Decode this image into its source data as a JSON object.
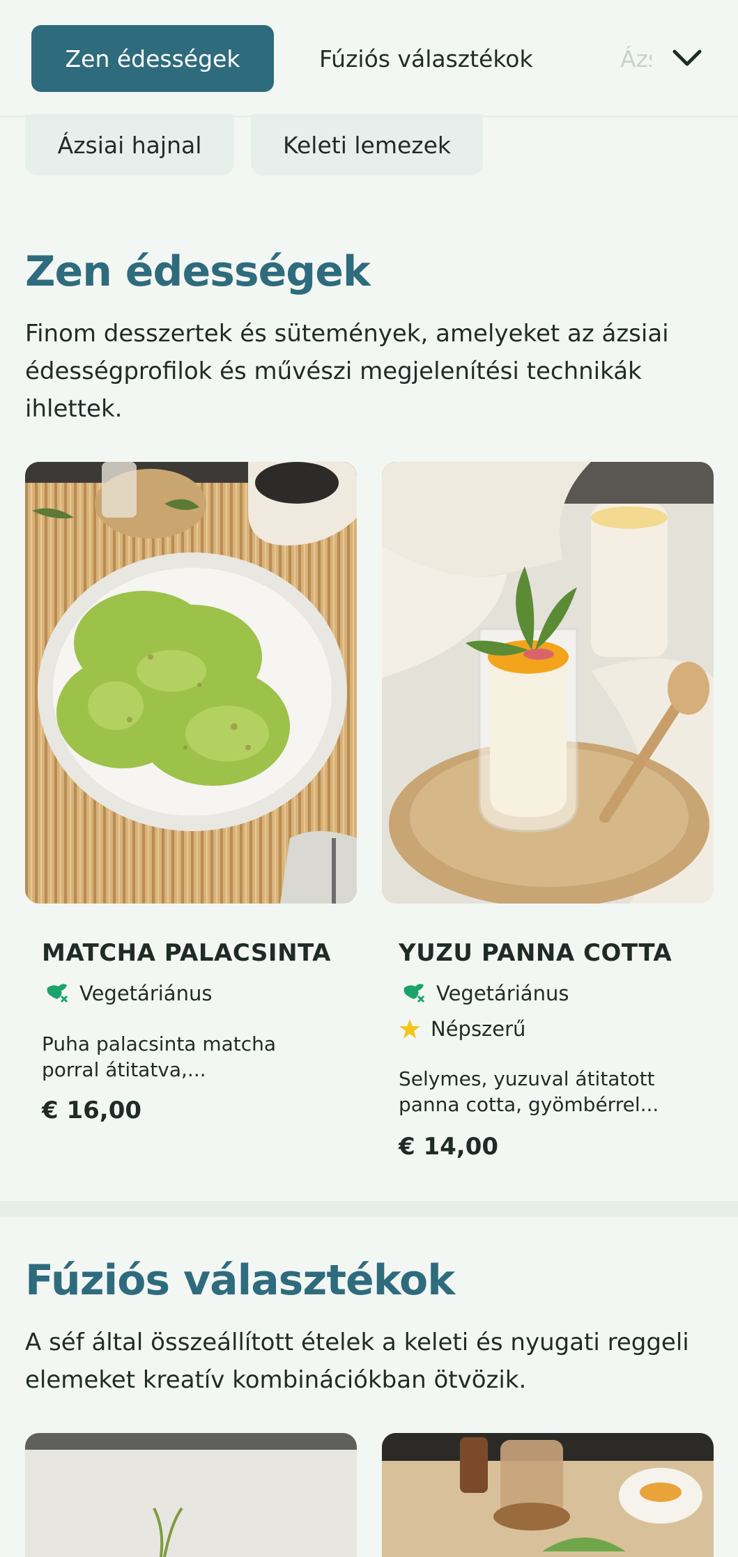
{
  "nav": {
    "tabs": [
      {
        "label": "Zen édességek"
      },
      {
        "label": "Fúziós választékok"
      },
      {
        "label": "Ázsiai hajnal"
      }
    ],
    "more_icon": "chevron-down-icon"
  },
  "subnav": {
    "chips": [
      {
        "label": "Ázsiai hajnal"
      },
      {
        "label": "Keleti lemezek"
      }
    ]
  },
  "sections": [
    {
      "title": "Zen édességek",
      "description": "Finom desszertek és sütemények, amelyeket az ázsiai édességprofilok és művészi megjelenítési technikák ihlettek.",
      "items": [
        {
          "name": "MATCHA PALACSINTA",
          "tags": [
            {
              "icon": "vegetarian-icon",
              "label": "Vegetáriánus"
            }
          ],
          "description": "Puha palacsinta matcha porral átitatva,...",
          "price": "€ 16,00"
        },
        {
          "name": "YUZU PANNA COTTA",
          "tags": [
            {
              "icon": "vegetarian-icon",
              "label": "Vegetáriánus"
            },
            {
              "icon": "star-icon",
              "label": "Népszerű"
            }
          ],
          "description": "Selymes, yuzuval átitatott panna cotta, gyömbérrel...",
          "price": "€ 14,00"
        }
      ]
    },
    {
      "title": "Fúziós választékok",
      "description": "A séf által összeállított ételek a keleti és nyugati reggeli elemeket kreatív kombinációkban ötvözik."
    }
  ],
  "colors": {
    "accent": "#2e6b7d",
    "background": "#f3f7f4",
    "vegetarian": "#1aa36a",
    "star": "#f5c518"
  }
}
